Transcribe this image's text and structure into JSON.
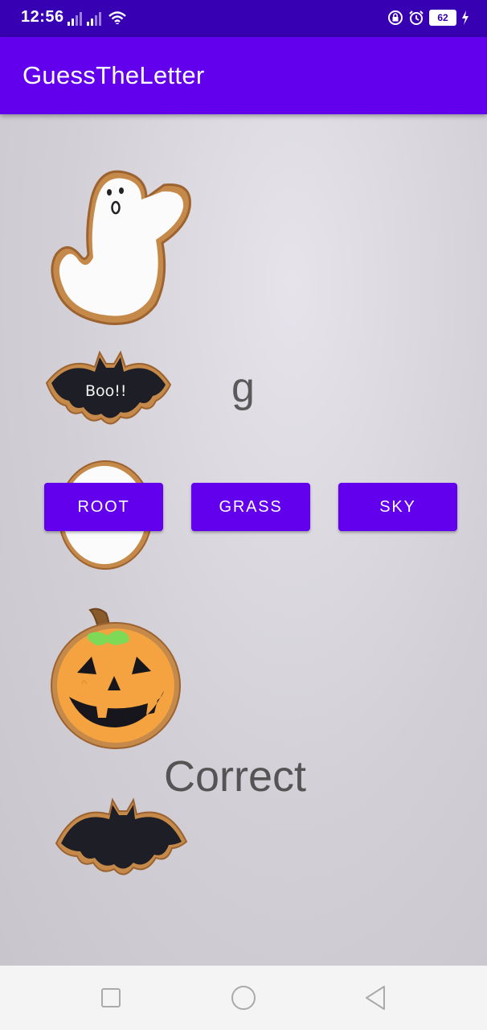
{
  "status_bar": {
    "time": "12:56",
    "battery": "62",
    "background_color": "#3700b3",
    "icons": [
      "signal-icon",
      "signal-icon",
      "wifi-icon",
      "lock-icon",
      "alarm-icon",
      "battery-icon",
      "charging-icon"
    ]
  },
  "app_bar": {
    "title": "GuessTheLetter",
    "background_color": "#6200ee"
  },
  "main": {
    "letter": "g",
    "options": [
      "ROOT",
      "GRASS",
      "SKY"
    ],
    "result": "Correct",
    "button_color": "#6200ee",
    "background_images": [
      "ghost-cookie",
      "bat-cookie",
      "round-cookie",
      "pumpkin-cookie",
      "bat-cookie"
    ],
    "bat_cookie_text": "Boo!!"
  },
  "nav_bar": {
    "buttons": [
      "recent-apps-button",
      "home-button",
      "back-button"
    ]
  }
}
